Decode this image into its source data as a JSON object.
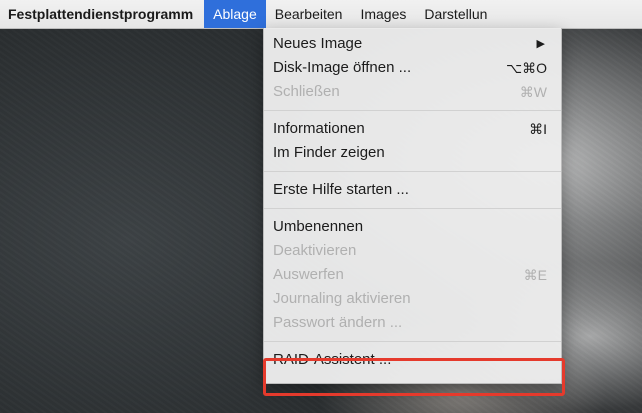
{
  "menubar": {
    "app_name": "Festplattendienstprogramm",
    "items": [
      {
        "label": "Ablage"
      },
      {
        "label": "Bearbeiten"
      },
      {
        "label": "Images"
      },
      {
        "label": "Darstellun"
      }
    ]
  },
  "menu": {
    "groups": [
      [
        {
          "label": "Neues Image",
          "shortcut": "",
          "submenu": true,
          "disabled": false
        },
        {
          "label": "Disk-Image öffnen ...",
          "shortcut": "⌥⌘O",
          "submenu": false,
          "disabled": false
        },
        {
          "label": "Schließen",
          "shortcut": "⌘W",
          "submenu": false,
          "disabled": true
        }
      ],
      [
        {
          "label": "Informationen",
          "shortcut": "⌘I",
          "submenu": false,
          "disabled": false
        },
        {
          "label": "Im Finder zeigen",
          "shortcut": "",
          "submenu": false,
          "disabled": false
        }
      ],
      [
        {
          "label": "Erste Hilfe starten ...",
          "shortcut": "",
          "submenu": false,
          "disabled": false
        }
      ],
      [
        {
          "label": "Umbenennen",
          "shortcut": "",
          "submenu": false,
          "disabled": false
        },
        {
          "label": "Deaktivieren",
          "shortcut": "",
          "submenu": false,
          "disabled": true
        },
        {
          "label": "Auswerfen",
          "shortcut": "⌘E",
          "submenu": false,
          "disabled": true
        },
        {
          "label": "Journaling aktivieren",
          "shortcut": "",
          "submenu": false,
          "disabled": true
        },
        {
          "label": "Passwort ändern ...",
          "shortcut": "",
          "submenu": false,
          "disabled": true
        }
      ],
      [
        {
          "label": "RAID-Assistent ...",
          "shortcut": "",
          "submenu": false,
          "disabled": false
        }
      ]
    ],
    "submenu_glyph": "▶"
  },
  "colors": {
    "menubar_active": "#2f6fdb",
    "highlight_outline": "#e53a2c",
    "disabled_text": "#b0b0b0"
  }
}
